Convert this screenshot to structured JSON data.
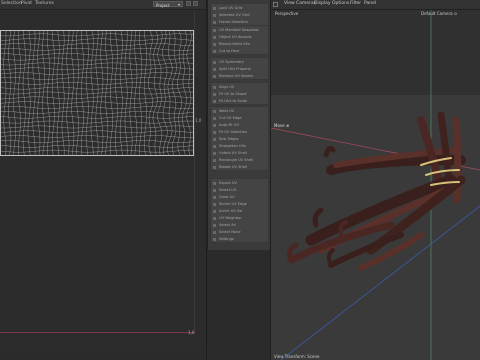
{
  "uv_editor": {
    "menu": [
      "Selection",
      "Pivot",
      "Textures"
    ],
    "dropdown_value": "Project",
    "bottom_label": "1,0",
    "right_label": "1,0"
  },
  "tool_panel": {
    "groups": [
      [
        "Lock UV Grid",
        "Selected UV Grid",
        "Frame Selection"
      ],
      [
        "UV Manifold Snapshot",
        "Object UV Bounds",
        "Relax/Unfold UVs",
        "Cut to Face"
      ],
      [
        "UV Symmetry",
        "Split UVs Properly",
        "Remove UV Seams"
      ],
      [
        "Align UV",
        "Fit UV to Shape",
        "Fit UVs to Scale"
      ],
      [
        "Weld UV",
        "Cut UV Edge",
        "Auto Fit UV",
        "Fit UV Selection",
        "Sew Edges",
        "Straighten UVs",
        "Unfold UV Shell",
        "Rectangle UV Shell",
        "Rotate UV Shell"
      ],
      [
        "Export UV",
        "Select UV",
        "Grow UV",
        "Shrink UV Edge",
        "Invert UV Sel",
        "UV Neighbor",
        "Select All",
        "Select None",
        "Settings"
      ]
    ]
  },
  "viewport": {
    "menu": [
      "View",
      "Cameras",
      "Display",
      "Options",
      "Filter",
      "Panel"
    ],
    "perspective_label": "Perspective",
    "camera_label": "Default Camera ⊙",
    "axis_label": "Move ⊕",
    "status_text": "View Transform: Scene"
  },
  "colors": {
    "axis_red": "#b04a5c",
    "axis_blue": "#3a62b8",
    "axis_green": "#4f8f6a",
    "wood_dark": "#3a201c",
    "wood_mid": "#5a302a",
    "rope": "#d8c27a"
  }
}
